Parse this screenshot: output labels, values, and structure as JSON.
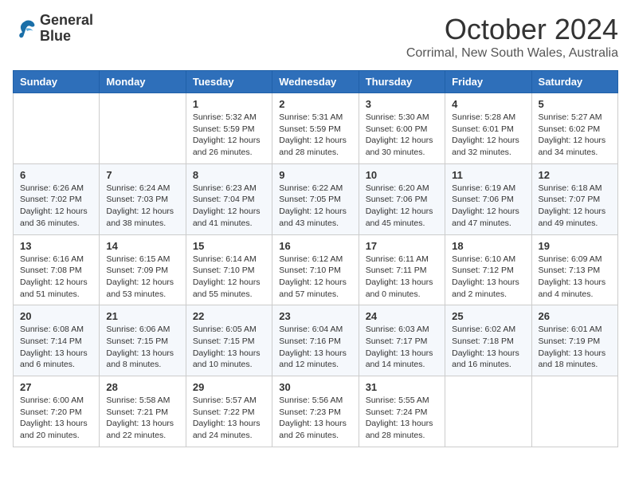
{
  "app": {
    "name_line1": "General",
    "name_line2": "Blue"
  },
  "title": "October 2024",
  "location": "Corrimal, New South Wales, Australia",
  "days_of_week": [
    "Sunday",
    "Monday",
    "Tuesday",
    "Wednesday",
    "Thursday",
    "Friday",
    "Saturday"
  ],
  "weeks": [
    [
      {
        "day": "",
        "info": ""
      },
      {
        "day": "",
        "info": ""
      },
      {
        "day": "1",
        "info": "Sunrise: 5:32 AM\nSunset: 5:59 PM\nDaylight: 12 hours and 26 minutes."
      },
      {
        "day": "2",
        "info": "Sunrise: 5:31 AM\nSunset: 5:59 PM\nDaylight: 12 hours and 28 minutes."
      },
      {
        "day": "3",
        "info": "Sunrise: 5:30 AM\nSunset: 6:00 PM\nDaylight: 12 hours and 30 minutes."
      },
      {
        "day": "4",
        "info": "Sunrise: 5:28 AM\nSunset: 6:01 PM\nDaylight: 12 hours and 32 minutes."
      },
      {
        "day": "5",
        "info": "Sunrise: 5:27 AM\nSunset: 6:02 PM\nDaylight: 12 hours and 34 minutes."
      }
    ],
    [
      {
        "day": "6",
        "info": "Sunrise: 6:26 AM\nSunset: 7:02 PM\nDaylight: 12 hours and 36 minutes."
      },
      {
        "day": "7",
        "info": "Sunrise: 6:24 AM\nSunset: 7:03 PM\nDaylight: 12 hours and 38 minutes."
      },
      {
        "day": "8",
        "info": "Sunrise: 6:23 AM\nSunset: 7:04 PM\nDaylight: 12 hours and 41 minutes."
      },
      {
        "day": "9",
        "info": "Sunrise: 6:22 AM\nSunset: 7:05 PM\nDaylight: 12 hours and 43 minutes."
      },
      {
        "day": "10",
        "info": "Sunrise: 6:20 AM\nSunset: 7:06 PM\nDaylight: 12 hours and 45 minutes."
      },
      {
        "day": "11",
        "info": "Sunrise: 6:19 AM\nSunset: 7:06 PM\nDaylight: 12 hours and 47 minutes."
      },
      {
        "day": "12",
        "info": "Sunrise: 6:18 AM\nSunset: 7:07 PM\nDaylight: 12 hours and 49 minutes."
      }
    ],
    [
      {
        "day": "13",
        "info": "Sunrise: 6:16 AM\nSunset: 7:08 PM\nDaylight: 12 hours and 51 minutes."
      },
      {
        "day": "14",
        "info": "Sunrise: 6:15 AM\nSunset: 7:09 PM\nDaylight: 12 hours and 53 minutes."
      },
      {
        "day": "15",
        "info": "Sunrise: 6:14 AM\nSunset: 7:10 PM\nDaylight: 12 hours and 55 minutes."
      },
      {
        "day": "16",
        "info": "Sunrise: 6:12 AM\nSunset: 7:10 PM\nDaylight: 12 hours and 57 minutes."
      },
      {
        "day": "17",
        "info": "Sunrise: 6:11 AM\nSunset: 7:11 PM\nDaylight: 13 hours and 0 minutes."
      },
      {
        "day": "18",
        "info": "Sunrise: 6:10 AM\nSunset: 7:12 PM\nDaylight: 13 hours and 2 minutes."
      },
      {
        "day": "19",
        "info": "Sunrise: 6:09 AM\nSunset: 7:13 PM\nDaylight: 13 hours and 4 minutes."
      }
    ],
    [
      {
        "day": "20",
        "info": "Sunrise: 6:08 AM\nSunset: 7:14 PM\nDaylight: 13 hours and 6 minutes."
      },
      {
        "day": "21",
        "info": "Sunrise: 6:06 AM\nSunset: 7:15 PM\nDaylight: 13 hours and 8 minutes."
      },
      {
        "day": "22",
        "info": "Sunrise: 6:05 AM\nSunset: 7:15 PM\nDaylight: 13 hours and 10 minutes."
      },
      {
        "day": "23",
        "info": "Sunrise: 6:04 AM\nSunset: 7:16 PM\nDaylight: 13 hours and 12 minutes."
      },
      {
        "day": "24",
        "info": "Sunrise: 6:03 AM\nSunset: 7:17 PM\nDaylight: 13 hours and 14 minutes."
      },
      {
        "day": "25",
        "info": "Sunrise: 6:02 AM\nSunset: 7:18 PM\nDaylight: 13 hours and 16 minutes."
      },
      {
        "day": "26",
        "info": "Sunrise: 6:01 AM\nSunset: 7:19 PM\nDaylight: 13 hours and 18 minutes."
      }
    ],
    [
      {
        "day": "27",
        "info": "Sunrise: 6:00 AM\nSunset: 7:20 PM\nDaylight: 13 hours and 20 minutes."
      },
      {
        "day": "28",
        "info": "Sunrise: 5:58 AM\nSunset: 7:21 PM\nDaylight: 13 hours and 22 minutes."
      },
      {
        "day": "29",
        "info": "Sunrise: 5:57 AM\nSunset: 7:22 PM\nDaylight: 13 hours and 24 minutes."
      },
      {
        "day": "30",
        "info": "Sunrise: 5:56 AM\nSunset: 7:23 PM\nDaylight: 13 hours and 26 minutes."
      },
      {
        "day": "31",
        "info": "Sunrise: 5:55 AM\nSunset: 7:24 PM\nDaylight: 13 hours and 28 minutes."
      },
      {
        "day": "",
        "info": ""
      },
      {
        "day": "",
        "info": ""
      }
    ]
  ]
}
